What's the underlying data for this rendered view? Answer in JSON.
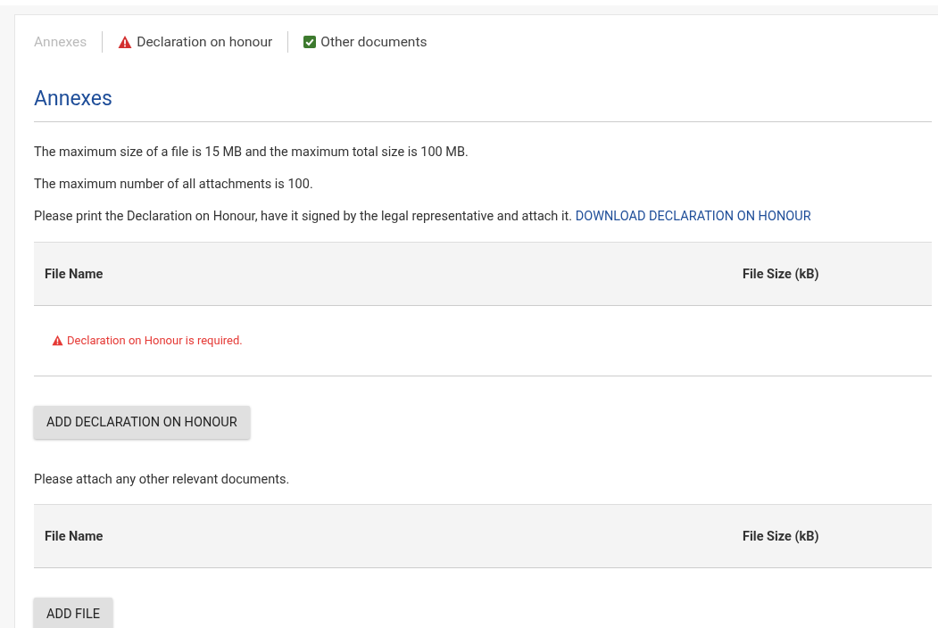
{
  "steps": [
    {
      "label": "Annexes",
      "warning": false,
      "done": false,
      "selected": true
    },
    {
      "label": "Declaration on honour",
      "warning": true,
      "done": false,
      "selected": false
    },
    {
      "label": "Other documents",
      "warning": false,
      "done": true,
      "selected": false
    }
  ],
  "title": "Annexes",
  "notes": [
    "The maximum size of a file is 15 MB and the maximum total size is 100 MB.",
    "The maximum number of all attachments is 100."
  ],
  "instruction": {
    "text": "Please print the Declaration on Honour, have it signed by the legal representative and attach it.",
    "link": "DOWNLOAD DECLARATION ON HONOUR"
  },
  "declaration_table": {
    "columns": [
      "File Name",
      "File Size (kB)"
    ],
    "error": "Declaration on Honour is required."
  },
  "declaration_button": "ADD DECLARATION ON HONOUR",
  "other_note": "Please attach any other relevant documents.",
  "other_table": {
    "columns": [
      "File Name",
      "File Size (kB)"
    ]
  },
  "other_button": "ADD FILE"
}
